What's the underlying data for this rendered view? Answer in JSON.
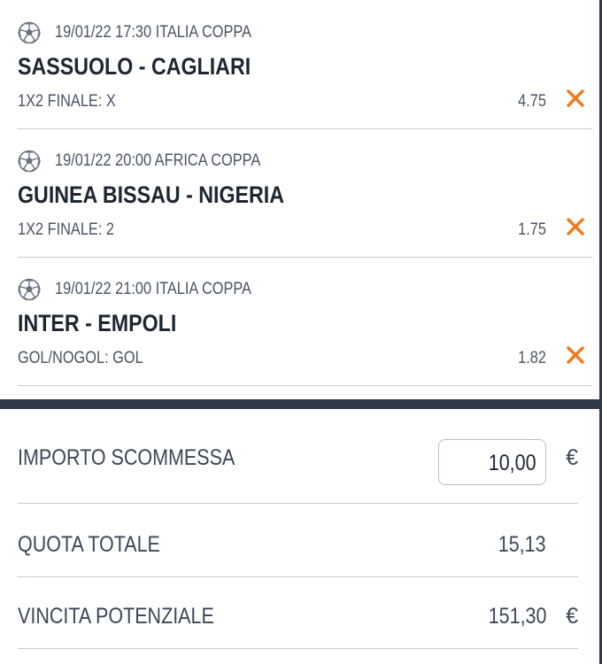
{
  "events": [
    {
      "datetime": "19/01/22 17:30",
      "competition": "ITALIA COPPA",
      "match": "SASSUOLO - CAGLIARI",
      "market": "1X2 FINALE: X",
      "odds": "4.75"
    },
    {
      "datetime": "19/01/22 20:00",
      "competition": "AFRICA COPPA",
      "match": "GUINEA BISSAU - NIGERIA",
      "market": "1X2 FINALE: 2",
      "odds": "1.75"
    },
    {
      "datetime": "19/01/22 21:00",
      "competition": "ITALIA COPPA",
      "match": "INTER - EMPOLI",
      "market": "GOL/NOGOL: GOL",
      "odds": "1.82"
    }
  ],
  "summary": {
    "stake_label": "IMPORTO SCOMMESSA",
    "stake_value": "10,00",
    "stake_currency": "€",
    "total_odds_label": "QUOTA TOTALE",
    "total_odds_value": "15,13",
    "potential_win_label": "VINCITA POTENZIALE",
    "potential_win_value": "151,30",
    "potential_win_currency": "€"
  },
  "icons": {
    "sport": "soccer-ball-icon",
    "remove": "close-icon"
  },
  "colors": {
    "accent_remove": "#f07a1a",
    "dark_band": "#2f3a46",
    "divider": "#c8cdd3"
  }
}
